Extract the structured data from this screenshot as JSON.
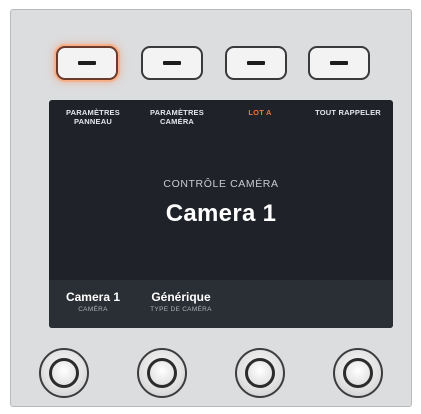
{
  "soft_buttons": [
    {
      "name": "softkey-1",
      "active": true
    },
    {
      "name": "softkey-2",
      "active": false
    },
    {
      "name": "softkey-3",
      "active": false
    },
    {
      "name": "softkey-4",
      "active": false
    }
  ],
  "screen": {
    "tabs": [
      {
        "line1": "PARAMÈTRES",
        "line2": "PANNEAU"
      },
      {
        "line1": "PARAMÈTRES",
        "line2": "CAMÉRA"
      },
      {
        "line1": "LOT A",
        "line2": ""
      },
      {
        "line1": "TOUT RAPPELER",
        "line2": ""
      }
    ],
    "mode_title": "CONTRÔLE CAMÉRA",
    "main_label": "Camera 1",
    "params": [
      {
        "value": "Camera 1",
        "label": "CAMÉRA"
      },
      {
        "value": "Générique",
        "label": "TYPE DE CAMÉRA"
      }
    ]
  },
  "colors": {
    "panel": "#dcdddf",
    "screen": "#1f2228",
    "active_tab": "#e07a48",
    "active_glow": "#f7b089"
  },
  "knobs": [
    "knob-1",
    "knob-2",
    "knob-3",
    "knob-4"
  ]
}
